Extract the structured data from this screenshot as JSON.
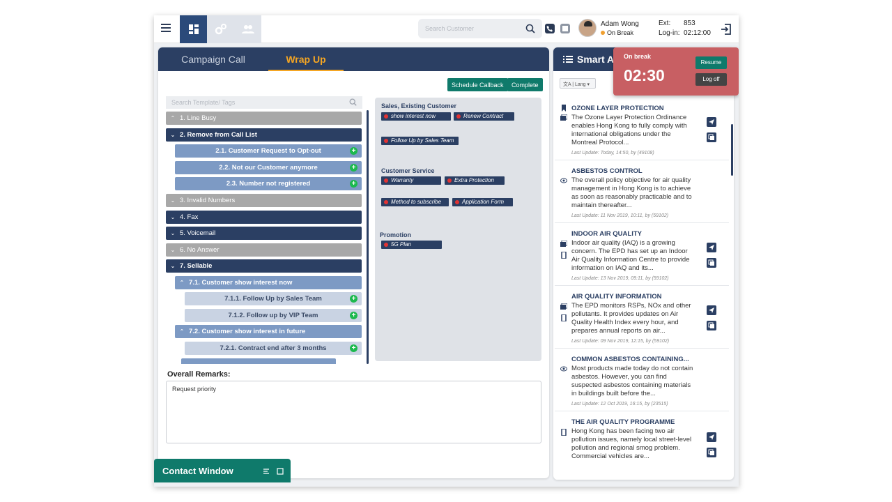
{
  "header": {
    "search_placeholder": "Search Customer",
    "user_name": "Adam Wong",
    "user_status": "On Break",
    "ext_label": "Ext:",
    "ext_value": "853",
    "login_label": "Log-in:",
    "login_value": "02:12:00"
  },
  "tabs": [
    "Campaign Call",
    "Wrap Up"
  ],
  "actions": {
    "schedule": "Schedule Callback",
    "complete": "Complete"
  },
  "template_search_placeholder": "Search Template/ Tags",
  "tree": [
    {
      "label": "1. Line Busy",
      "chev": "^"
    },
    {
      "label": "2. Remove from Call List",
      "chev": "v"
    },
    {
      "label": "2.1. Customer Request to Opt-out"
    },
    {
      "label": "2.2. Not our Customer anymore"
    },
    {
      "label": "2.3. Number not registered"
    },
    {
      "label": "3. Invalid Numbers",
      "chev": "v"
    },
    {
      "label": "4. Fax",
      "chev": "v"
    },
    {
      "label": "5. Voicemail",
      "chev": "v"
    },
    {
      "label": "6. No Answer",
      "chev": "v"
    },
    {
      "label": "7. Sellable",
      "chev": "v"
    },
    {
      "label": "7.1. Customer show interest now",
      "chev": "^"
    },
    {
      "label": "7.1.1. Follow Up by Sales Team"
    },
    {
      "label": "7.1.2. Follow up by VIP Team"
    },
    {
      "label": "7.2. Customer show interest in future",
      "chev": "^"
    },
    {
      "label": "7.2.1. Contract end after 3 months"
    }
  ],
  "quick": {
    "sales_head": "Sales, Existing Customer",
    "chip_show_interest": "show interest now",
    "chip_renew": "Renew Contract",
    "chip_follow": "Follow Up by Sales Team",
    "service_head": "Customer Service",
    "chip_warranty": "Warranty",
    "chip_extra": "Extra Protection",
    "chip_method": "Method to subscribe",
    "chip_app_form": "Application Form",
    "promo_head": "Promotion",
    "chip_5g": "5G Plan"
  },
  "remarks": {
    "label": "Overall Remarks:",
    "value": "Request priority"
  },
  "contact_window": "Contact Window",
  "smart_panel": {
    "title": "Smart A",
    "lang": "Lang"
  },
  "kb": [
    {
      "title": "OZONE LAYER PROTECTION",
      "body": "The Ozone Layer Protection Ordinance enables Hong Kong to fully comply with international obligations under the Montreal Protocol...",
      "meta": "Last Update: Today, 14:50, by (49108)"
    },
    {
      "title": "ASBESTOS CONTROL",
      "body": "The overall policy objective for air quality management in Hong Kong is to achieve as soon as reasonably practicable and to maintain thereafter...",
      "meta": "Last Update: 11 Nov 2019, 10:11, by (59102)"
    },
    {
      "title": "INDOOR AIR QUALITY",
      "body": "Indoor air quality (IAQ) is a growing concern. The EPD has set up an Indoor Air Quality Information Centre to provide information on IAQ and its...",
      "meta": "Last Update: 13 Nov 2019, 09:11, by (59102)"
    },
    {
      "title": "AIR QUALITY INFORMATION",
      "body": "The EPD monitors RSPs, NOx and other pollutants. It provides updates on Air Quality Health Index every hour, and prepares annual reports on air...",
      "meta": "Last Update: 09 Nov 2019, 12:15, by (59102)"
    },
    {
      "title": "COMMON ASBESTOS CONTAINING...",
      "body": "Most products made today do not contain asbestos. However, you can find suspected asbestos containing materials in buildings built before the...",
      "meta": "Last Update: 12 Oct 2019, 16:15, by (23515)"
    },
    {
      "title": "THE AIR QUALITY PROGRAMME",
      "body": "Hong Kong has been facing two air pollution issues, namely local street-level pollution and regional smog problem. Commercial vehicles are...",
      "meta": ""
    }
  ],
  "break": {
    "label": "On break",
    "timer": "02:30",
    "resume": "Resume",
    "logoff": "Log off"
  }
}
